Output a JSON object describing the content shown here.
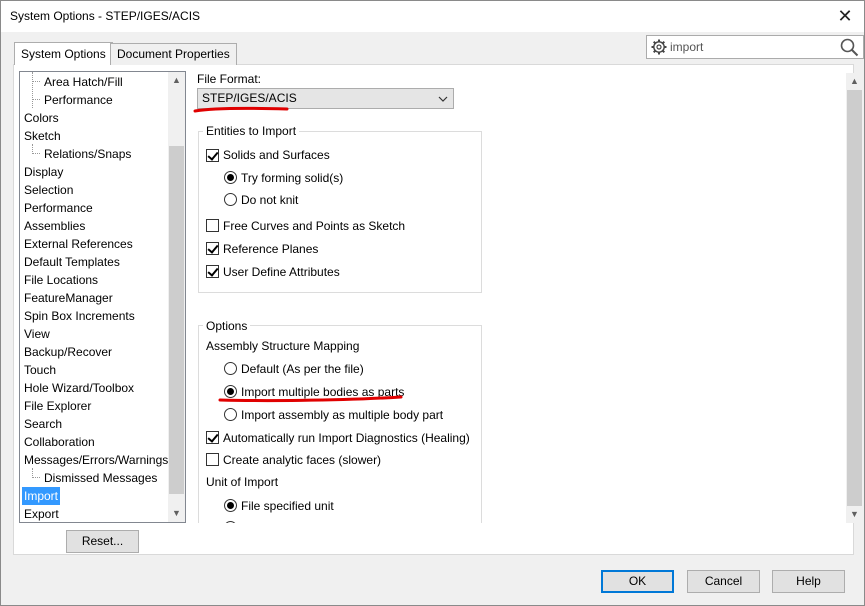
{
  "window": {
    "title": "System Options - STEP/IGES/ACIS",
    "close_glyph": "✕"
  },
  "tabs": [
    {
      "label": "System Options",
      "active": true
    },
    {
      "label": "Document Properties",
      "active": false
    }
  ],
  "search": {
    "value": "import",
    "gear_icon": "gear-icon",
    "search_icon": "magnifier-icon"
  },
  "tree": {
    "items": [
      {
        "label": "Area Hatch/Fill",
        "level": 1
      },
      {
        "label": "Performance",
        "level": 1
      },
      {
        "label": "Colors",
        "level": 0
      },
      {
        "label": "Sketch",
        "level": 0
      },
      {
        "label": "Relations/Snaps",
        "level": 1
      },
      {
        "label": "Display",
        "level": 0
      },
      {
        "label": "Selection",
        "level": 0
      },
      {
        "label": "Performance",
        "level": 0
      },
      {
        "label": "Assemblies",
        "level": 0
      },
      {
        "label": "External References",
        "level": 0
      },
      {
        "label": "Default Templates",
        "level": 0
      },
      {
        "label": "File Locations",
        "level": 0
      },
      {
        "label": "FeatureManager",
        "level": 0
      },
      {
        "label": "Spin Box Increments",
        "level": 0
      },
      {
        "label": "View",
        "level": 0
      },
      {
        "label": "Backup/Recover",
        "level": 0
      },
      {
        "label": "Touch",
        "level": 0
      },
      {
        "label": "Hole Wizard/Toolbox",
        "level": 0
      },
      {
        "label": "File Explorer",
        "level": 0
      },
      {
        "label": "Search",
        "level": 0
      },
      {
        "label": "Collaboration",
        "level": 0
      },
      {
        "label": "Messages/Errors/Warnings",
        "level": 0
      },
      {
        "label": "Dismissed Messages",
        "level": 1
      },
      {
        "label": "Import",
        "level": 0,
        "selected": true
      },
      {
        "label": "Export",
        "level": 0
      }
    ]
  },
  "reset_label": "Reset...",
  "file_format": {
    "label": "File Format:",
    "value": "STEP/IGES/ACIS"
  },
  "entities": {
    "title": "Entities to Import",
    "solids_surfaces": {
      "label": "Solids and Surfaces",
      "checked": true
    },
    "try_forming": {
      "label": "Try forming solid(s)",
      "checked": true
    },
    "do_not_knit": {
      "label": "Do not knit",
      "checked": false
    },
    "free_curves": {
      "label": "Free Curves and Points as Sketch",
      "checked": false
    },
    "reference_planes": {
      "label": "Reference Planes",
      "checked": true
    },
    "user_define": {
      "label": "User Define Attributes",
      "checked": true
    }
  },
  "options": {
    "title": "Options",
    "assembly_mapping": "Assembly Structure Mapping",
    "default_per_file": {
      "label": "Default (As per the file)",
      "checked": false
    },
    "import_multiple_bodies": {
      "label": "Import multiple bodies as parts",
      "checked": true
    },
    "import_assembly_multibody": {
      "label": "Import assembly as multiple body part",
      "checked": false
    },
    "auto_diagnostics": {
      "label": "Automatically run Import Diagnostics (Healing)",
      "checked": true
    },
    "analytic_faces": {
      "label": "Create analytic faces (slower)",
      "checked": false
    },
    "unit_of_import": "Unit of Import",
    "file_specified_unit": {
      "label": "File specified unit",
      "checked": true
    }
  },
  "footer": {
    "ok": "OK",
    "cancel": "Cancel",
    "help": "Help"
  },
  "colors": {
    "selection": "#3399ff",
    "annotation_red": "#e00000",
    "default_button_border": "#0078d7"
  }
}
